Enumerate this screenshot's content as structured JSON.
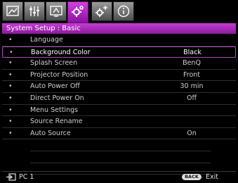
{
  "tabs": [
    {
      "name": "picture",
      "icon": "picture-icon"
    },
    {
      "name": "picture-advanced",
      "icon": "equalizer-icon"
    },
    {
      "name": "display",
      "icon": "display-icon"
    },
    {
      "name": "system-setup-basic",
      "icon": "gear-icon",
      "active": true
    },
    {
      "name": "system-setup-advanced",
      "icon": "gears-plus-icon"
    },
    {
      "name": "information",
      "icon": "info-icon"
    }
  ],
  "header": {
    "title": "System Setup : Basic"
  },
  "menu": {
    "items": [
      {
        "bullet": "•",
        "label": "Language",
        "value": ""
      },
      {
        "bullet": "•",
        "label": "Background Color",
        "value": "Black",
        "selected": true
      },
      {
        "bullet": "•",
        "label": "Splash Screen",
        "value": "BenQ"
      },
      {
        "bullet": "•",
        "label": "Projector Position",
        "value": "Front"
      },
      {
        "bullet": "•",
        "label": "Auto Power Off",
        "value": "30 min"
      },
      {
        "bullet": "•",
        "label": "Direct Power On",
        "value": "Off"
      },
      {
        "bullet": "•",
        "label": "Menu Settings",
        "value": ""
      },
      {
        "bullet": "•",
        "label": "Source Rename",
        "value": ""
      },
      {
        "bullet": "•",
        "label": "Auto Source",
        "value": "On"
      }
    ]
  },
  "footer": {
    "source_icon": "input-source-icon",
    "source_label": "PC 1",
    "back_label": "BACK",
    "exit_label": "Exit"
  },
  "colors": {
    "accent": "#b030c0",
    "background": "#000000",
    "tab": "#7a7a7a"
  }
}
